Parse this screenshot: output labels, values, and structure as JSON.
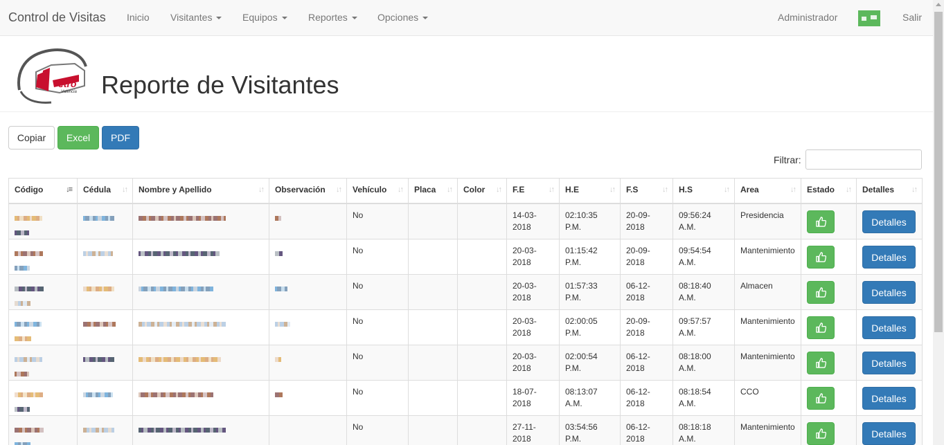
{
  "navbar": {
    "brand": "Control de Visitas",
    "items": [
      {
        "label": "Inicio",
        "dropdown": false
      },
      {
        "label": "Visitantes",
        "dropdown": true
      },
      {
        "label": "Equipos",
        "dropdown": true
      },
      {
        "label": "Reportes",
        "dropdown": true
      },
      {
        "label": "Opciones",
        "dropdown": true
      }
    ],
    "user": "Administrador",
    "logout": "Salir"
  },
  "page": {
    "title": "Reporte de Visitantes",
    "logo_text": "etro",
    "logo_subtext": "Valencia"
  },
  "toolbar": {
    "copy": "Copiar",
    "excel": "Excel",
    "pdf": "PDF",
    "filter_label": "Filtrar:"
  },
  "table": {
    "columns": [
      "Código",
      "Cédula",
      "Nombre y Apellido",
      "Observación",
      "Vehículo",
      "Placa",
      "Color",
      "F.E",
      "H.E",
      "F.S",
      "H.S",
      "Area",
      "Estado",
      "Detalles"
    ],
    "rows": [
      {
        "vehiculo": "No",
        "fe": "14-03-2018",
        "he": "02:10:35 P.M.",
        "fs": "20-09-2018",
        "hs": "09:56:24 A.M.",
        "area": "Presidencia",
        "detalles": "Detalles"
      },
      {
        "vehiculo": "No",
        "fe": "20-03-2018",
        "he": "01:15:42 P.M.",
        "fs": "20-09-2018",
        "hs": "09:54:54 A.M.",
        "area": "Mantenimiento",
        "detalles": "Detalles"
      },
      {
        "vehiculo": "No",
        "fe": "20-03-2018",
        "he": "01:57:33 P.M.",
        "fs": "06-12-2018",
        "hs": "08:18:40 A.M.",
        "area": "Almacen",
        "detalles": "Detalles"
      },
      {
        "vehiculo": "No",
        "fe": "20-03-2018",
        "he": "02:00:05 P.M.",
        "fs": "20-09-2018",
        "hs": "09:57:57 A.M.",
        "area": "Mantenimiento",
        "detalles": "Detalles"
      },
      {
        "vehiculo": "No",
        "fe": "20-03-2018",
        "he": "02:00:54 P.M.",
        "fs": "06-12-2018",
        "hs": "08:18:00 A.M.",
        "area": "Mantenimiento",
        "detalles": "Detalles"
      },
      {
        "vehiculo": "No",
        "fe": "18-07-2018",
        "he": "08:13:07 A.M.",
        "fs": "06-12-2018",
        "hs": "08:18:54 A.M.",
        "area": "CCO",
        "detalles": "Detalles"
      },
      {
        "vehiculo": "No",
        "fe": "27-11-2018",
        "he": "03:54:56 P.M.",
        "fs": "06-12-2018",
        "hs": "08:18:18 A.M.",
        "area": "Mantenimiento",
        "detalles": "Detalles"
      }
    ]
  },
  "colors": {
    "success": "#5cb85c",
    "primary": "#337ab7",
    "logo_red": "#c8102e"
  },
  "icons": {
    "estado": "thumbs-up-icon",
    "sort": "sort-icon",
    "user": "user-badge-icon"
  }
}
